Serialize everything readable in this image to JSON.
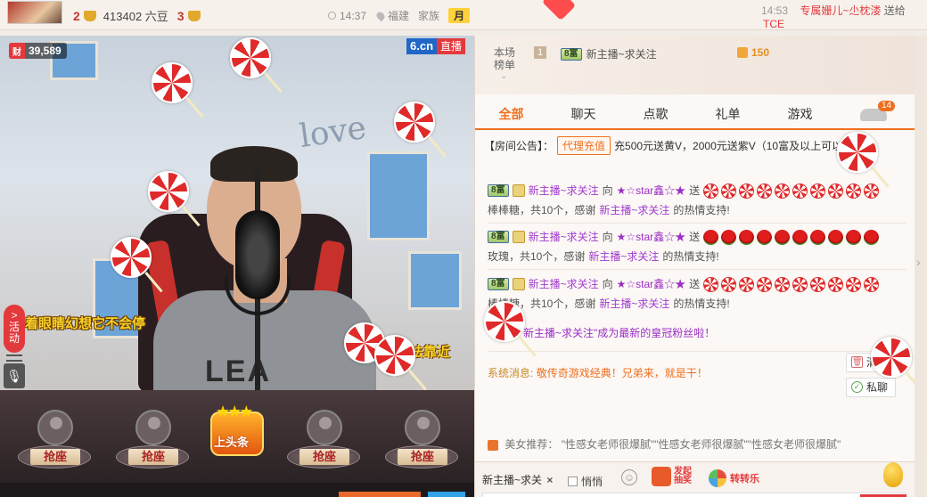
{
  "top": {
    "rank1": "2",
    "beans": "413402 六豆",
    "rank2": "3",
    "time": "14:37",
    "location": "福建",
    "family_label": "家族",
    "month_badge": "月",
    "time_right": "14:53",
    "marquee_user": "专属姗儿~尐枕溇",
    "marquee_action": "送给",
    "marquee_tail": "TCE"
  },
  "video": {
    "wealth_tag": "财",
    "wealth_value": "39,589",
    "brand_logo": "6.cn",
    "brand_live": "直播",
    "shirt_text": "LEA",
    "overlay_left": "着眼睛幻想它不会停",
    "overlay_right": "法靠近",
    "activity_label": "活动",
    "activity_arrow": ">",
    "wall_text": "love"
  },
  "seats": [
    {
      "label": "抢座"
    },
    {
      "label": "抢座"
    },
    {
      "label": "抢座"
    },
    {
      "label": "抢座"
    }
  ],
  "headline": {
    "label": "上头条",
    "stars": "★★★"
  },
  "rank_panel": {
    "label_line1": "本场",
    "label_line2": "榜单",
    "position": "1",
    "rich_badge": "8富",
    "user": "新主播~求关注",
    "coins": "150"
  },
  "tabs": [
    {
      "label": "全部"
    },
    {
      "label": "聊天"
    },
    {
      "label": "点歌"
    },
    {
      "label": "礼单"
    },
    {
      "label": "游戏"
    }
  ],
  "car_badge": "14",
  "notice": {
    "label": "【房间公告】：",
    "button": "代理充值",
    "text": "充500元送黄V，2000元送紫V（10富及以上可以"
  },
  "messages": [
    {
      "badge": "8富",
      "sender": "新主播~求关注",
      "to": "向",
      "receiver": "★☆star鑫☆★",
      "send": "送",
      "gift_type": "lollipop",
      "line2_a": "棒棒糖，共10个，感谢",
      "line2_name": "新主播~求关注",
      "line2_b": "的热情支持!"
    },
    {
      "badge": "8富",
      "sender": "新主播~求关注",
      "to": "向",
      "receiver": "★☆star鑫☆★",
      "send": "送",
      "gift_type": "rose",
      "line2_a": "玫瑰，共10个，感谢",
      "line2_name": "新主播~求关注",
      "line2_b": "的热情支持!"
    },
    {
      "badge": "8富",
      "sender": "新主播~求关注",
      "to": "向",
      "receiver": "★☆star鑫☆★",
      "send": "送",
      "gift_type": "lollipop",
      "line2_a": "棒棒糖，共10个，感谢",
      "line2_name": "新主播~求关注",
      "line2_b": "的热情支持!"
    }
  ],
  "join_msg": "新主播~求关注\"成为最新的皇冠粉丝啦！",
  "system": {
    "label": "系统消息:",
    "text": "敬传奇游戏经典！兄弟来，就是干！"
  },
  "actions": {
    "clear": "清",
    "private": "私聊"
  },
  "recommend": {
    "label": "美女推荐：",
    "text": "\"性感女老师很爆腻\"\"性感女老师很爆腻\"\"性感女老师很爆腻\""
  },
  "input": {
    "target": "新主播~求关",
    "close": "×",
    "quiet": "悄悄",
    "lottery_line1": "发起",
    "lottery_line2": "抽奖",
    "wheel": "转转乐"
  },
  "colors": {
    "accent": "#ef6f1f",
    "red": "#e4393c",
    "purple": "#9b2ec6"
  }
}
